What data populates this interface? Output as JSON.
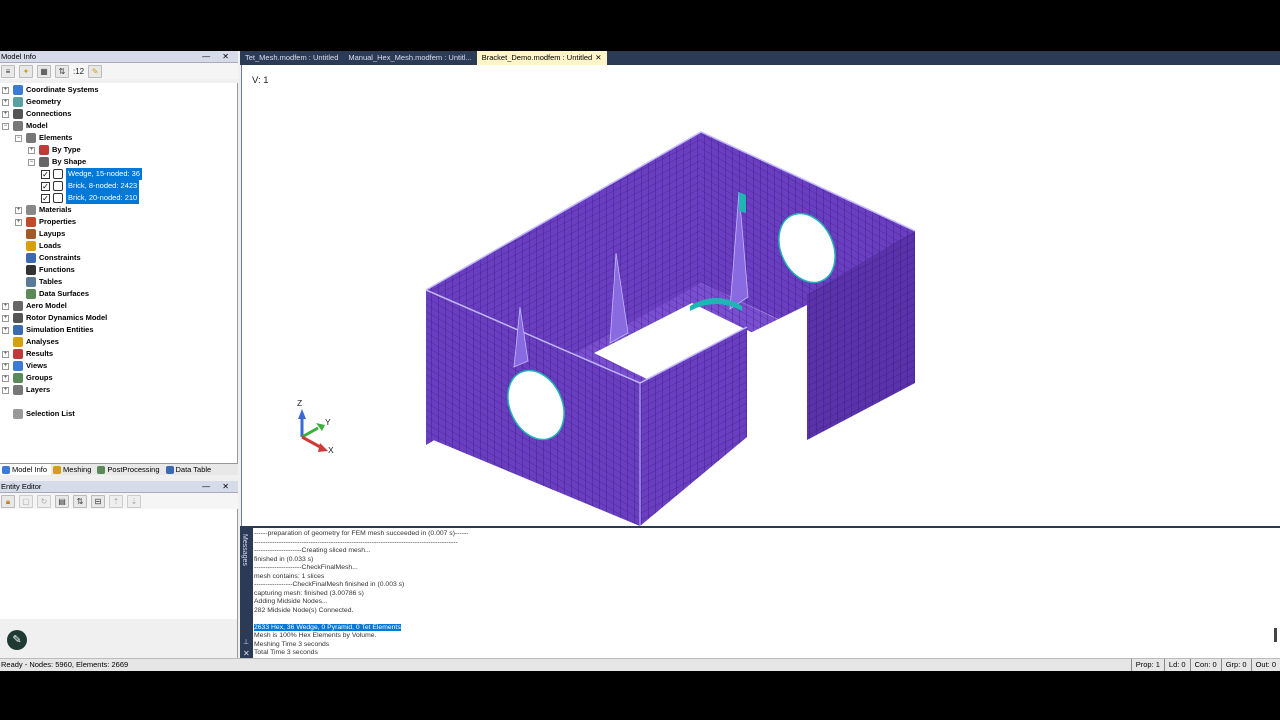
{
  "model_info": {
    "title": "Model Info",
    "controls": "— ✕",
    "toolbar_count": ":12",
    "tree": [
      {
        "label": "Coordinate Systems",
        "level": 0,
        "expander": "+",
        "icon_color": "#3a7bd5"
      },
      {
        "label": "Geometry",
        "level": 0,
        "expander": "+",
        "icon_color": "#5aa0a0"
      },
      {
        "label": "Connections",
        "level": 0,
        "expander": "+",
        "icon_color": "#555"
      },
      {
        "label": "Model",
        "level": 0,
        "expander": "−",
        "icon_color": "#777"
      },
      {
        "label": "Elements",
        "level": 1,
        "expander": "−",
        "icon_color": "#777"
      },
      {
        "label": "By Type",
        "level": 2,
        "expander": "+",
        "icon_color": "#c03a3a"
      },
      {
        "label": "By Shape",
        "level": 2,
        "expander": "−",
        "icon_color": "#666"
      },
      {
        "label": "Wedge, 15-noded: 36",
        "level": 3,
        "checked": true,
        "selected": true
      },
      {
        "label": "Brick, 8-noded: 2423",
        "level": 3,
        "checked": true,
        "selected": true
      },
      {
        "label": "Brick, 20-noded: 210",
        "level": 3,
        "checked": true,
        "selected": true
      },
      {
        "label": "Materials",
        "level": 1,
        "expander": "+",
        "icon_color": "#888"
      },
      {
        "label": "Properties",
        "level": 1,
        "expander": "+",
        "icon_color": "#c04a2a"
      },
      {
        "label": "Layups",
        "level": 1,
        "expander": "",
        "icon_color": "#a05a2a"
      },
      {
        "label": "Loads",
        "level": 1,
        "expander": "",
        "icon_color": "#d4a010"
      },
      {
        "label": "Constraints",
        "level": 1,
        "expander": "",
        "icon_color": "#3a6ab0"
      },
      {
        "label": "Functions",
        "level": 1,
        "expander": "",
        "icon_color": "#333"
      },
      {
        "label": "Tables",
        "level": 1,
        "expander": "",
        "icon_color": "#5a7a9a"
      },
      {
        "label": "Data Surfaces",
        "level": 1,
        "expander": "",
        "icon_color": "#5a8a5a"
      },
      {
        "label": "Aero Model",
        "level": 0,
        "expander": "+",
        "icon_color": "#666"
      },
      {
        "label": "Rotor Dynamics Model",
        "level": 0,
        "expander": "+",
        "icon_color": "#555"
      },
      {
        "label": "Simulation Entities",
        "level": 0,
        "expander": "+",
        "icon_color": "#3a6ab0"
      },
      {
        "label": "Analyses",
        "level": 0,
        "expander": "",
        "icon_color": "#d4a010"
      },
      {
        "label": "Results",
        "level": 0,
        "expander": "+",
        "icon_color": "#c03a3a"
      },
      {
        "label": "Views",
        "level": 0,
        "expander": "+",
        "icon_color": "#3a7bd5"
      },
      {
        "label": "Groups",
        "level": 0,
        "expander": "+",
        "icon_color": "#5a8a5a"
      },
      {
        "label": "Layers",
        "level": 0,
        "expander": "+",
        "icon_color": "#777"
      },
      {
        "label": "Selection List",
        "level": 0,
        "expander": "",
        "icon_color": "#999",
        "gap": true
      }
    ],
    "tabs": [
      "Model Info",
      "Meshing",
      "PostProcessing",
      "Data Table"
    ]
  },
  "entity_editor": {
    "title": "Entity Editor",
    "controls": "— ✕"
  },
  "document_tabs": [
    {
      "label": "Tet_Mesh.modfem : Untitled",
      "active": false
    },
    {
      "label": "Manual_Hex_Mesh.modfem : Untitl...",
      "active": false
    },
    {
      "label": "Bracket_Demo.modfem : Untitled",
      "active": true
    }
  ],
  "viewport": {
    "view_label": "V: 1",
    "axes": {
      "z": "Z",
      "y": "Y",
      "x": "X"
    },
    "colors": {
      "mesh_face": "#6a3ec0",
      "mesh_line": "#2a1670",
      "accent": "#1fb5b5"
    }
  },
  "messages": {
    "side_label": "Messages",
    "lines": [
      "------preparation of geometry for FEM mesh succeeded in (0.007 s)------",
      "------------------------------------------------------------------------------------------",
      "---------------------Creating sliced mesh...",
      "finished in (0.033 s)",
      "---------------------CheckFinalMesh...",
      "mesh contains: 1 slices",
      "-----------------CheckFinalMesh finished in (0.003 s)",
      "capturing mesh: finished (3.00786 s)",
      "Adding Midside Nodes...",
      "282 Midside Node(s) Connected.",
      "",
      "2633 Hex, 36 Wedge, 0 Pyramid, 0 Tet Elements",
      "Mesh is 100% Hex Elements by Volume.",
      "Meshing Time 3 seconds",
      "Total Time 3 seconds"
    ],
    "highlight_index": 11
  },
  "status": {
    "left": "Ready - Nodes: 5960,  Elements: 2669",
    "cells": [
      "Prop: 1",
      "Ld: 0",
      "Con: 0",
      "Grp: 0",
      "Out: 0"
    ]
  }
}
